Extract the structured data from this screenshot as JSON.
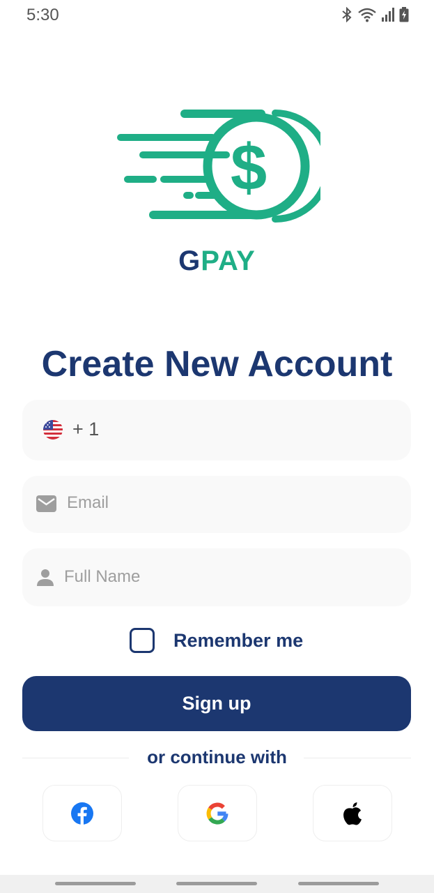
{
  "status_bar": {
    "time": "5:30"
  },
  "brand": {
    "name_first": "G",
    "name_rest": "PAY"
  },
  "page": {
    "title": "Create New Account"
  },
  "form": {
    "phone_code": "+ 1",
    "email_placeholder": "Email",
    "name_placeholder": "Full Name",
    "remember_label": "Remember me",
    "signup_label": "Sign up"
  },
  "social": {
    "divider_text": "or continue with"
  },
  "colors": {
    "primary": "#1c3770",
    "accent": "#1fae86",
    "field_bg": "#f9f9f9"
  },
  "icons": [
    "bluetooth-icon",
    "wifi-icon",
    "signal-icon",
    "battery-icon",
    "mail-icon",
    "person-icon",
    "facebook-icon",
    "google-icon",
    "apple-icon"
  ]
}
